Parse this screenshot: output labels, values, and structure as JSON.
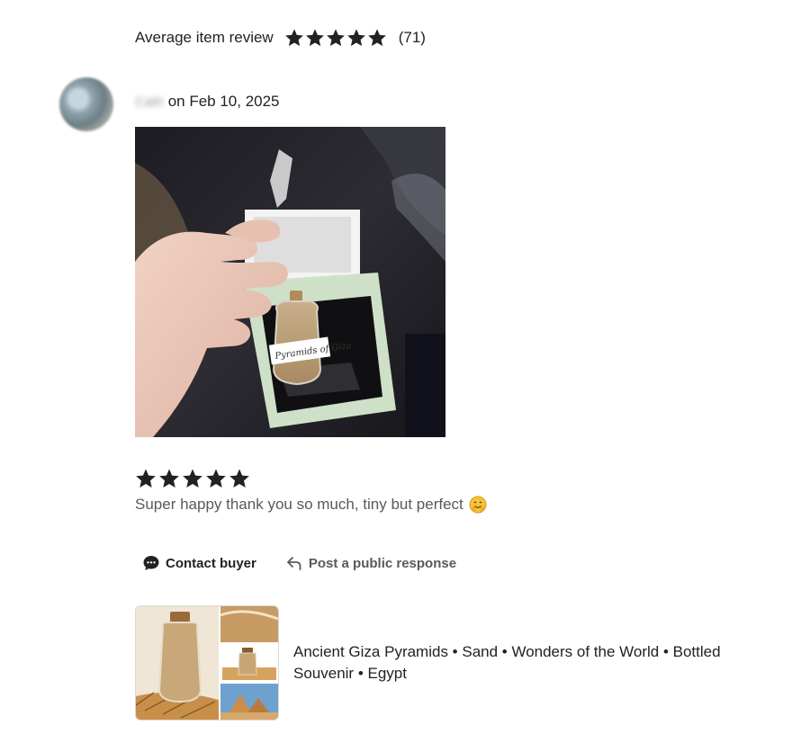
{
  "summary": {
    "label": "Average item review",
    "rating_stars": 5,
    "count": "(71)"
  },
  "review": {
    "reviewer_name": "Cath",
    "date_text": "on Feb 10, 2025",
    "photo_label": "Pyramids of Giza",
    "rating_stars": 5,
    "text": "Super happy thank you so much, tiny but perfect"
  },
  "actions": {
    "contact_label": "Contact buyer",
    "post_label": "Post a public response"
  },
  "item": {
    "title": "Ancient Giza Pyramids • Sand • Wonders of the World • Bottled Souvenir • Egypt"
  },
  "colors": {
    "star": "#222222",
    "text_primary": "#222222",
    "text_secondary": "#595959"
  },
  "icons": {
    "star": "star-icon",
    "contact": "chat-bubble-icon",
    "post": "reply-arrow-icon",
    "emoji": "hugging-face-emoji-icon"
  }
}
